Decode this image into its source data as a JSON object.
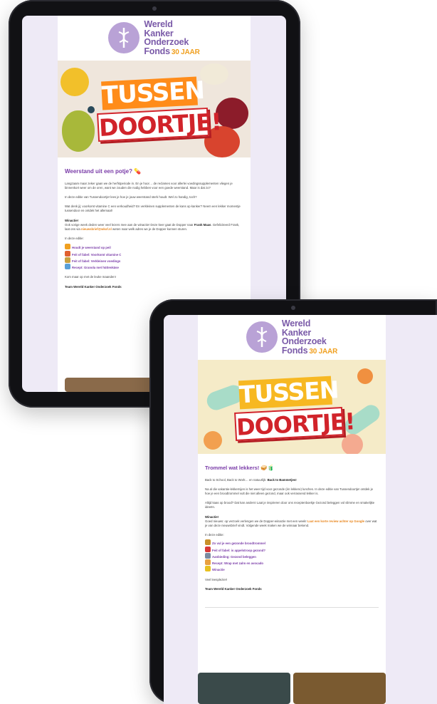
{
  "logo": {
    "line1": "Wereld",
    "line2": "Kanker",
    "line3": "Onderzoek",
    "line4": "Fonds",
    "anniversary": "30 JAAR"
  },
  "hero": {
    "line1": "TUSSEN",
    "line2": "DOORTJE!"
  },
  "tablet1": {
    "headline": "Weerstand uit een potje? 💊",
    "p1": "Langzaam maar zeker gaan we de herfstperiode in. En je hoor… de reclames voor allerlei voedingssupplementen vliegen je binnenkort weer om de oren, want we zouden die nodig hebben voor een goede weerstand. Maar is dat zo?",
    "p2": "In deze editie van Tussendoortje! lees je hoe je jouw weerstand sterk houdt. Wel zo handig, toch?",
    "p3": "Wat denk jij: voorkomt vitamine C een verkoudheid? En verkleinen supplementen de kans op kanker? Neem een lekker momentje tussendoor en ontdek het allemaal!",
    "winactie_title": "Winactie!",
    "winactie_text1": "Ook vorige week deden weer veel lezers mee aan de winactie! Deze keer gaat de Dopper naar",
    "winner": "Frank Maas",
    "winactie_text2": ". Gefeliciteerd Frank, laat ons via",
    "winactie_link": "nieuwsbrief@wkof.nl",
    "winactie_text3": "weten naar welk adres we je de Dopper kunnen sturen.",
    "list_title": "In deze editie:",
    "items": [
      "Houdt je weerstand op peil",
      "Feit of fabel: Voorkomt vitamine C",
      "Feit of fabel: Verkleinen voedings",
      "Recept: Granola met hüttenkäse"
    ],
    "closing": "Kom maar op met de leuke maanden!",
    "team": "Team Wereld Kanker Onderzoek Fonds"
  },
  "tablet2": {
    "headline": "Trommel wat lekkers! 🥪🧃",
    "p1_pre": "Back to School, Back to Work… en natuurlijk:",
    "p1_bold": "Back to Bammetjes!",
    "p2": "Na al die vakantie-lekkernijen is het weer tijd voor gezonde (én lekkere) lunches. In deze editie van Tussendoortje! ontdek je hoe je een broodtrommel vult die niet alleen gezond, maar ook verrassend lekker is.",
    "p3": "Altijd kaas op brood? Dat kan anders! Laat je inspireren door ons receptenboekje Gezond beleggen vol slimme en smakelijke ideeën.",
    "winactie_title": "Winactie!",
    "winactie_text1": "Goed nieuws: op verzoek verlengen we de Dopper-winactie met een week!",
    "winactie_link": "Laat een korte review achter op Google",
    "winactie_text2": "over wat je van deze nieuwsbrief vindt. Volgende week maken we de winnaar bekend.",
    "list_title": "In deze editie:",
    "items": [
      "Zo vul je een gezonde broodtrommel",
      "Feit of fabel: is appelstroop gezond?",
      "Aanbieding: Gezond beleggen",
      "Recept: Wrap met zalm en avocado",
      "Winactie"
    ],
    "closing": "Veel leesplezier!",
    "team": "Team Wereld Kanker Onderzoek Fonds"
  },
  "colors": {
    "brand_purple": "#7a3ca8",
    "brand_orange": "#f0a020",
    "sign_red": "#d1232a"
  }
}
